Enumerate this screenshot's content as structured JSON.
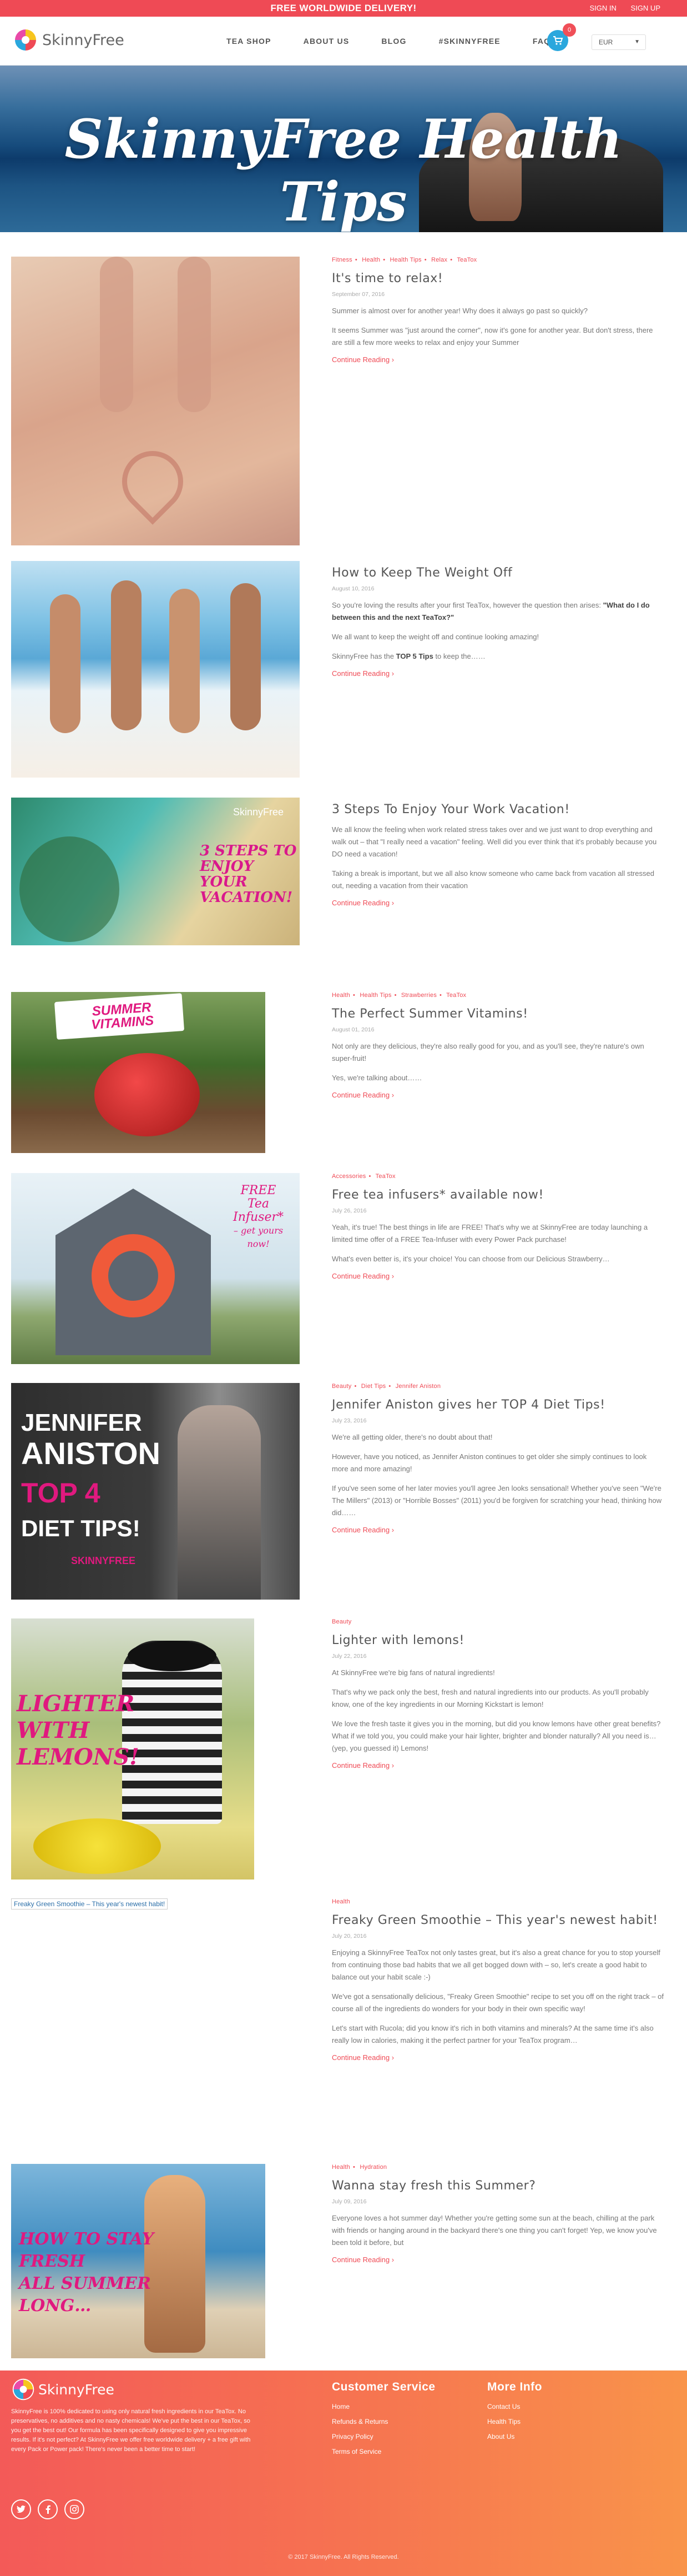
{
  "topbar": {
    "promo": "FREE WORLDWIDE DELIVERY!",
    "signin": "SIGN IN",
    "signup": "SIGN UP"
  },
  "header": {
    "logo_text": "SkinnyFree",
    "nav": [
      "TEA SHOP",
      "ABOUT US",
      "BLOG",
      "#SKINNYFREE",
      "FAQ"
    ],
    "cart_count": "0",
    "currency": "EUR"
  },
  "hero": {
    "title": "SkinnyFree Health Tips"
  },
  "posts": [
    {
      "categories": [
        "Fitness",
        "Health",
        "Health Tips",
        "Relax",
        "TeaTox"
      ],
      "title": "It's time to relax!",
      "date": "September 07, 2016",
      "p": [
        "Summer is almost over for another year! Why does it always go past so quickly?",
        "It seems Summer was \"just around the corner\", now it's gone for another year. But don't stress, there are still a few more weeks to relax and enjoy your Summer"
      ],
      "more": "Continue Reading ›"
    },
    {
      "categories": [],
      "title": "How to Keep The Weight Off",
      "date": "August 10, 2016",
      "p1a": "So you're loving the results after your first TeaTox, however the question then arises: ",
      "p1b": "\"What do I do between this and the next TeaTox?\"",
      "p2": "We all want to keep the weight off and continue looking amazing!",
      "p3a": "SkinnyFree has the ",
      "p3b": "TOP 5 Tips",
      " p3c": "",
      "p3c": " to keep the……",
      "more": "Continue Reading ›"
    },
    {
      "categories": [],
      "title": "3 Steps To Enjoy Your Work Vacation!",
      "date": "",
      "p": [
        "We all know the feeling when work related stress takes over and we just want to drop everything and walk out – that \"I really need a vacation\" feeling. Well did you ever think that it's probably because you DO need a vacation!",
        "Taking a break is important, but we all also know someone who came back from vacation all stressed out, needing a vacation from their vacation"
      ],
      "more": "Continue Reading ›"
    },
    {
      "categories": [
        "Health",
        "Health Tips",
        "Strawberries",
        "TeaTox"
      ],
      "title": "The Perfect Summer Vitamins!",
      "date": "August 01, 2016",
      "p": [
        "Not only are they delicious, they're also really good for you, and as you'll see, they're nature's own super-fruit!",
        "Yes, we're talking about……"
      ],
      "more": "Continue Reading ›"
    },
    {
      "categories": [
        "Accessories",
        "TeaTox"
      ],
      "title": "Free tea infusers* available now!",
      "date": "July 26, 2016",
      "p": [
        "Yeah, it's true! The best things in life are FREE! That's why we at SkinnyFree are today launching a limited time offer of a FREE Tea-Infuser with every Power Pack purchase!",
        "What's even better is, it's your choice! You can choose from our Delicious Strawberry…"
      ],
      "more": "Continue Reading ›"
    },
    {
      "categories": [
        "Beauty",
        "Diet Tips",
        "Jennifer Aniston"
      ],
      "title": "Jennifer Aniston gives her TOP 4 Diet Tips!",
      "date": "July 23, 2016",
      "p": [
        "We're all getting older, there's no doubt about that!",
        "However, have you noticed, as Jennifer Aniston continues to get older she simply continues to look more and more amazing!",
        "If you've seen some of her later movies you'll agree Jen looks sensational! Whether you've seen \"We're The Millers\" (2013) or \"Horrible Bosses\" (2011) you'd be forgiven for scratching your head, thinking how did……"
      ],
      "more": "Continue Reading ›"
    },
    {
      "categories": [
        "Beauty"
      ],
      "title": "Lighter with lemons!",
      "date": "July 22, 2016",
      "p": [
        "At SkinnyFree we're big fans of natural ingredients!",
        "That's why we pack only the best, fresh and natural ingredients into our products. As you'll probably know, one of the key ingredients in our Morning Kickstart is lemon!",
        "We love the fresh taste it gives you in the morning, but did you know lemons have other great benefits? What if we told you, you could make your hair lighter, brighter and blonder naturally? All you need is… (yep, you guessed it) Lemons!"
      ],
      "more": "Continue Reading ›"
    },
    {
      "categories": [
        "Health"
      ],
      "title": "Freaky Green Smoothie – This year's newest habit!",
      "date": "July 20, 2016",
      "alt": "Freaky Green Smoothie – This year's newest habit!",
      "p": [
        "Enjoying a SkinnyFree TeaTox not only tastes great, but it's also a great chance for you to stop yourself from continuing those bad habits that we all get bogged down with – so, let's create a good habit to balance out your habit scale :-)",
        "We've got a sensationally delicious, \"Freaky Green Smoothie\" recipe to set you off on the right track – of course all of the ingredients do wonders for your body in their own specific way!",
        "Let's start with Rucola; did you know it's rich in both vitamins and minerals? At the same time it's also really low in calories, making it the perfect partner for your TeaTox program…"
      ],
      "more": "Continue Reading ›"
    },
    {
      "categories": [
        "Health",
        "Hydration"
      ],
      "title": "Wanna stay fresh this Summer?",
      "date": "July 09, 2016",
      "p": [
        "Everyone loves a hot summer day! Whether you're getting some sun at the beach, chilling at the park with friends or hanging around in the backyard there's one thing you can't forget! Yep, we know you've been told it before, but"
      ],
      "more": "Continue Reading ›"
    }
  ],
  "thumbs": {
    "p3": [
      "3 STEPS TO",
      "ENJOY YOUR",
      "VACATION!"
    ],
    "p3logo": "SkinnyFree",
    "p4": "SUMMER VITAMINS",
    "p5": [
      "FREE",
      "Tea",
      "Infuser*",
      "– get yours",
      "now!"
    ],
    "p6": [
      "JENNIFER",
      "ANISTON",
      "TOP 4",
      "DIET TIPS!",
      "SKINNYFREE"
    ],
    "p7": [
      "LIGHTER",
      "WITH",
      "LEMONS!"
    ],
    "p9": [
      "HOW TO STAY",
      "FRESH",
      "ALL SUMMER",
      "LONG…"
    ]
  },
  "footer": {
    "logo_text": "SkinnyFree",
    "desc": "SkinnyFree is 100% dedicated to using only natural fresh ingredients in our TeaTox. No preservatives, no additives and no nasty chemicals! We've put the best in our TeaTox, so you get the best out! Our formula has been specifically designed to give you impressive results. If it's not perfect? At SkinnyFree we offer free worldwide delivery + a free gift with every Pack or Power pack! There's never been a better time to start!",
    "col1_title": "Customer Service",
    "col1": [
      "Home",
      "Refunds & Returns",
      "Privacy Policy",
      "Terms of Service"
    ],
    "col2_title": "More Info",
    "col2": [
      "Contact Us",
      "Health Tips",
      "About Us"
    ],
    "copyright": "© 2017 SkinnyFree. All Rights Reserved."
  },
  "colors": {
    "accent": "#ef4a55",
    "cart": "#2aa7dd"
  }
}
